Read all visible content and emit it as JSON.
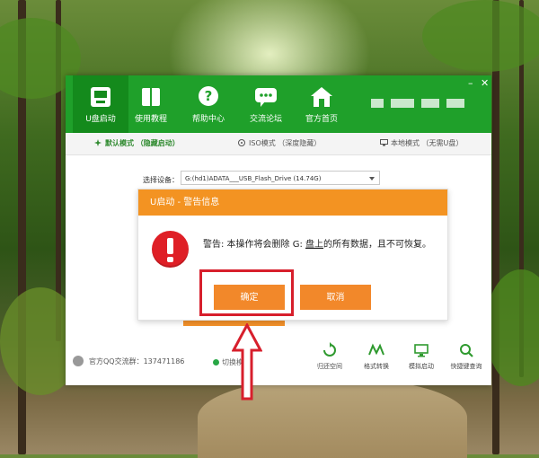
{
  "app": {
    "nav": [
      {
        "label": "U盘启动",
        "icon": "usb-drive-icon",
        "active": true
      },
      {
        "label": "使用教程",
        "icon": "book-icon",
        "active": false
      },
      {
        "label": "帮助中心",
        "icon": "question-icon",
        "active": false
      },
      {
        "label": "交流论坛",
        "icon": "chat-icon",
        "active": false
      },
      {
        "label": "官方首页",
        "icon": "home-icon",
        "active": false
      }
    ],
    "window_controls": {
      "minimize": "–",
      "close": "✕"
    }
  },
  "mode_tabs": [
    {
      "label": "默认模式 （隐藏启动）",
      "active": true
    },
    {
      "label": "ISO模式 （深度隐藏）",
      "active": false
    },
    {
      "label": "本地模式 （无需U盘）",
      "active": false
    }
  ],
  "device": {
    "label": "选择设备：",
    "value": "G:(hd1)ADATA___USB_Flash_Drive (14.74G)"
  },
  "footer": {
    "qq_group": "官方QQ交流群：137471186",
    "mode_text": "切换模式",
    "tools": [
      {
        "label": "归还空间",
        "icon": "restore-icon"
      },
      {
        "label": "格式转换",
        "icon": "ntfs-icon"
      },
      {
        "label": "模拟启动",
        "icon": "monitor-icon"
      },
      {
        "label": "快捷键查询",
        "icon": "search-icon"
      }
    ]
  },
  "dialog": {
    "title": "U启动 - 警告信息",
    "message_prefix": "警告: 本操作将会删除 G: ",
    "message_underlined": "盘上",
    "message_suffix": "的所有数据，且不可恢复。",
    "ok_label": "确定",
    "cancel_label": "取消"
  },
  "colors": {
    "brand_green": "#1fa02a",
    "dialog_orange": "#f39322",
    "button_orange": "#f2882a",
    "warning_red": "#df1f26",
    "highlight_red": "#d71f2c"
  }
}
